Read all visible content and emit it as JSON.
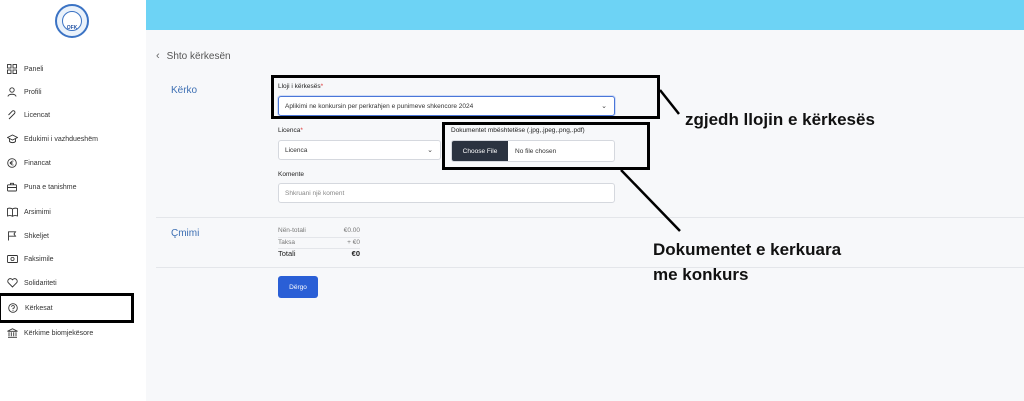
{
  "sidebar": {
    "logo_text": "OFK",
    "items": [
      {
        "label": "Paneli",
        "icon": "grid-icon"
      },
      {
        "label": "Profili",
        "icon": "user-icon"
      },
      {
        "label": "Licencat",
        "icon": "clip-icon"
      },
      {
        "label": "Edukimi i vazhdueshëm",
        "icon": "graduation-cap-icon"
      },
      {
        "label": "Financat",
        "icon": "euro-icon"
      },
      {
        "label": "Puna e tanishme",
        "icon": "briefcase-icon"
      },
      {
        "label": "Arsimimi",
        "icon": "book-icon"
      },
      {
        "label": "Shkeljet",
        "icon": "flag-icon"
      },
      {
        "label": "Faksimile",
        "icon": "id-card-icon"
      },
      {
        "label": "Solidariteti",
        "icon": "heart-icon"
      },
      {
        "label": "Kërkesat",
        "icon": "help-circle-icon"
      },
      {
        "label": "Kërkime biomjekësore",
        "icon": "bank-icon"
      }
    ]
  },
  "main": {
    "back_label": "Shto kërkesën",
    "request_section": {
      "title": "Kërko",
      "type_label": "Lloji i kërkesës",
      "type_value": "Aplikimi ne konkursin per perkrahjen e punimeve shkencore 2024",
      "license_label": "Licenca",
      "license_value": "Licenca",
      "docs_label": "Dokumentet mbështetëse (.jpg,.jpeg,.png,.pdf)",
      "choose_file": "Choose File",
      "no_file": "No file chosen",
      "comment_label": "Komente",
      "comment_placeholder": "Shkruani një koment",
      "required_mark": "*"
    },
    "price_section": {
      "title": "Çmimi",
      "subtotal_label": "Nën-totali",
      "subtotal_value": "€0.00",
      "tax_label": "Taksa",
      "tax_value": "+ €0",
      "total_label": "Totali",
      "total_value": "€0"
    },
    "submit_label": "Dërgo"
  },
  "annotations": {
    "type_note": "zgjedh llojin e kërkesës",
    "docs_note_line1": "Dokumentet e kerkuara",
    "docs_note_line2": "me konkurs"
  },
  "colors": {
    "topbar": "#6dd3f5",
    "accent": "#2a5fd6",
    "section_title": "#3d6fb3",
    "file_button": "#2b3340"
  }
}
